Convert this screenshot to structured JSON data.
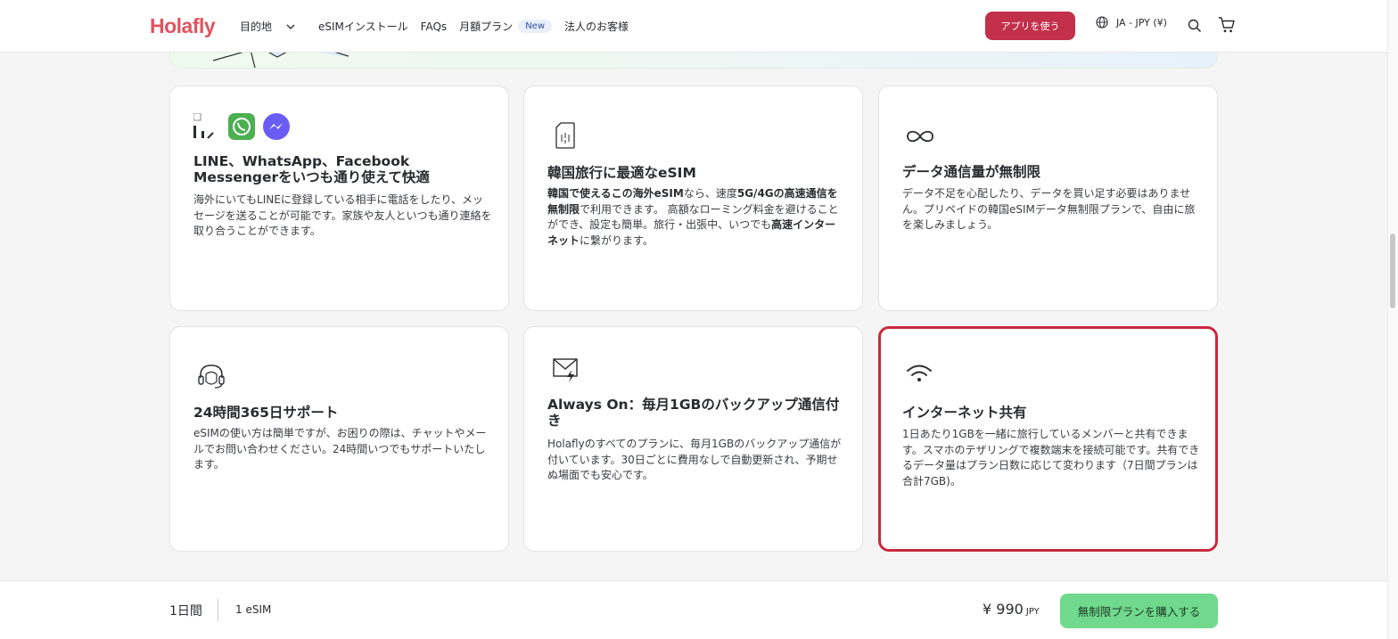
{
  "nav": {
    "logo": "Holafly",
    "destination": "目的地",
    "install": "eSIMインストール",
    "faqs": "FAQs",
    "monthly": "月額プラン",
    "new_badge": "New",
    "business": "法人のお客様",
    "app_button": "アプリを使う",
    "locale": "JA - JPY (¥)"
  },
  "cards": [
    {
      "title": "LINE、WhatsApp、Facebook Messengerをいつも通り使えて快適",
      "desc": "海外にいてもLINEに登録している相手に電話をしたり、メッセージを送ることが可能です。家族や友人といつも通り連絡を取り合うことができます。"
    },
    {
      "title": "韓国旅行に最適なeSIM",
      "desc_parts": [
        "韓国で使えるこの海外eSIM",
        "なら、速度",
        "5G/4Gの高速通信を無制限",
        "で利用できます。 高額なローミング料金を避けることができ、設定も簡単。旅行・出張中、いつでも",
        "高速インターネット",
        "に繋がります。"
      ]
    },
    {
      "title": "データ通信量が無制限",
      "desc": "データ不足を心配したり、データを買い足す必要はありません。プリペイドの韓国eSIMデータ無制限プランで、自由に旅を楽しみましょう。"
    },
    {
      "title": "24時間365日サポート",
      "desc": "eSIMの使い方は簡単ですが、お困りの際は、チャットやメールでお問い合わせください。24時間いつでもサポートいたします。"
    },
    {
      "title": "Always On：毎月1GBのバックアップ通信付き",
      "desc": "Holaflyのすべてのプランに、毎月1GBのバックアップ通信が付いています。30日ごとに費用なしで自動更新され、予期せぬ場面でも安心です。"
    },
    {
      "title": "インターネット共有",
      "desc": "1日あたり1GBを一緒に旅行しているメンバーと共有できます。スマホのテザリングで複数端末を接続可能です。共有できるデータ量はプラン日数に応じて変わります（7日間プランは合計7GB)。"
    }
  ],
  "bottom": {
    "days": "1日間",
    "esim": "1 eSIM",
    "price": "¥ 990",
    "currency": "JPY",
    "buy_button": "無制限プランを購入する"
  },
  "colors": {
    "brand": "#e0535f",
    "app_button": "#c2304a",
    "highlight_border": "#c72a3c",
    "buy_button": "#70d98d"
  }
}
